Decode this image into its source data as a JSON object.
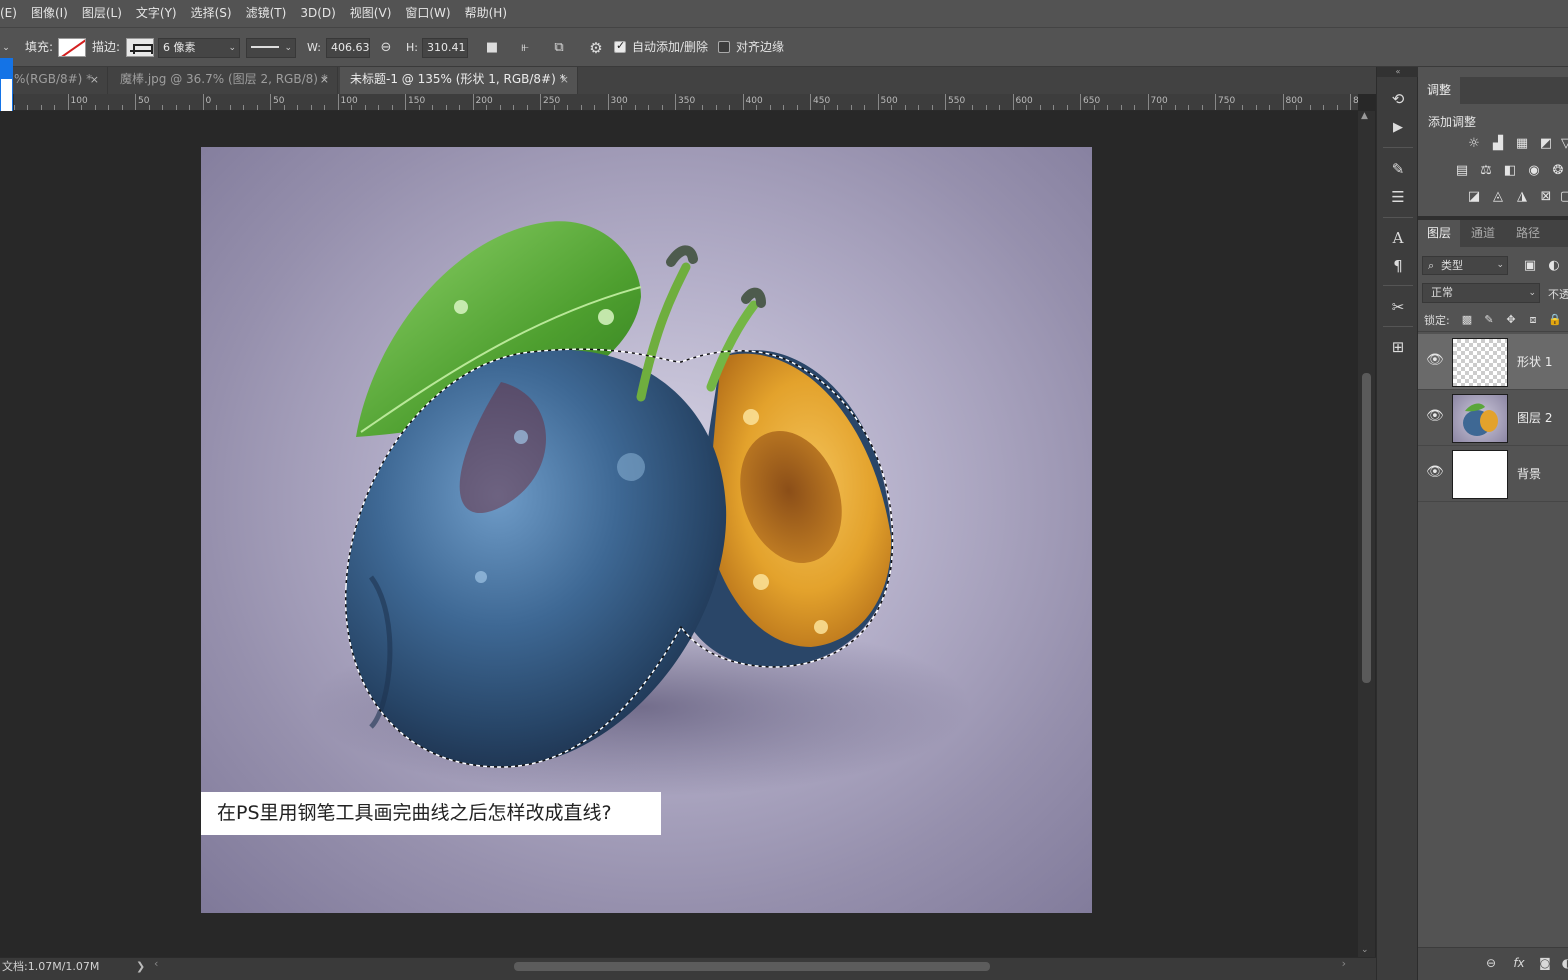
{
  "menu": [
    "(E)",
    "图像(I)",
    "图层(L)",
    "文字(Y)",
    "选择(S)",
    "滤镜(T)",
    "3D(D)",
    "视图(V)",
    "窗口(W)",
    "帮助(H)"
  ],
  "options": {
    "fill_label": "填充:",
    "stroke_label": "描边:",
    "stroke_width": "6 像素",
    "w_label": "W:",
    "w_value": "406.63 (",
    "h_label": "H:",
    "h_value": "310.41 (",
    "auto_add_delete": "自动添加/删除",
    "align_edges": "对齐边缘"
  },
  "tabs": [
    {
      "label": "%(RGB/8#) *"
    },
    {
      "label": "魔棒.jpg @ 36.7% (图层 2, RGB/8) *"
    },
    {
      "label": "未标题-1 @ 135% (形状 1, RGB/8#) *"
    }
  ],
  "ruler_labels": [
    "0",
    "100",
    "50",
    "0",
    "50",
    "100",
    "150",
    "200",
    "250",
    "300",
    "350",
    "400",
    "450",
    "500",
    "550",
    "600",
    "650",
    "700",
    "750",
    "800",
    "8"
  ],
  "canvas": {
    "caption": "在PS里用钢笔工具画完曲线之后怎样改成直线?"
  },
  "status": {
    "doc": "文档:1.07M/1.07M",
    "arrow": "❯"
  },
  "panels": {
    "adjust_tab": "调整",
    "add_adjust": "添加调整",
    "layer_tabs": [
      "图层",
      "通道",
      "路径"
    ],
    "filter_kind": "类型",
    "blend_mode": "正常",
    "opacity_label": "不透",
    "lock_label": "锁定:",
    "layers": [
      {
        "name": "形状 1"
      },
      {
        "name": "图层 2"
      },
      {
        "name": "背景"
      }
    ]
  },
  "colors": {
    "accent": "#1473e6",
    "fill_swatch_slash": "#d42020"
  }
}
